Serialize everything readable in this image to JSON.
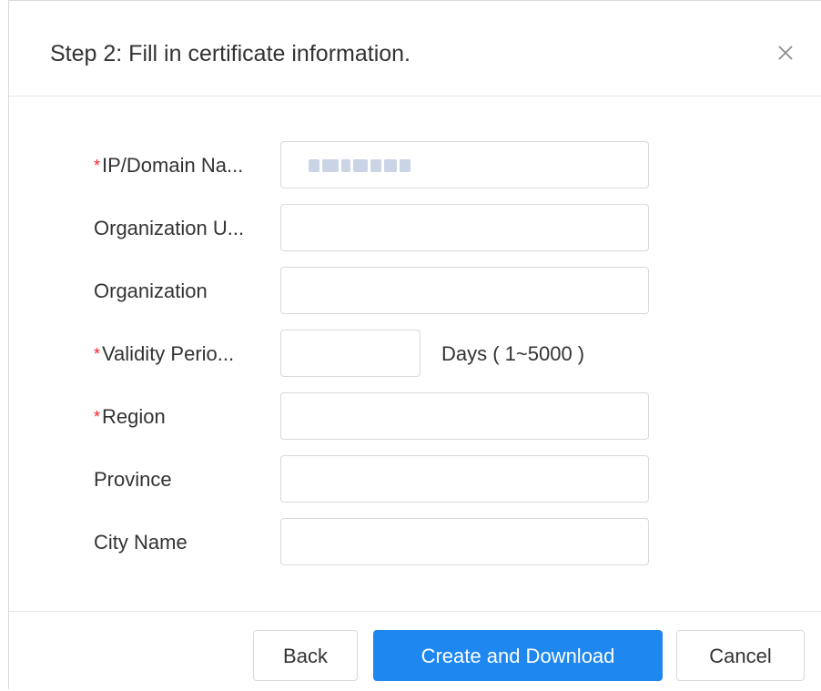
{
  "dialog": {
    "title": "Step 2: Fill in certificate information.",
    "close_icon": "close-icon"
  },
  "form": {
    "fields": [
      {
        "label": "IP/Domain Na...",
        "required": true,
        "value": "",
        "blurred": true
      },
      {
        "label": "Organization U...",
        "required": false,
        "value": ""
      },
      {
        "label": "Organization",
        "required": false,
        "value": ""
      },
      {
        "label": "Validity Perio...",
        "required": true,
        "value": "",
        "suffix": "Days ( 1~5000 )"
      },
      {
        "label": "Region",
        "required": true,
        "value": ""
      },
      {
        "label": "Province",
        "required": false,
        "value": ""
      },
      {
        "label": "City Name",
        "required": false,
        "value": ""
      }
    ],
    "required_mark": "*"
  },
  "footer": {
    "back_label": "Back",
    "create_label": "Create and Download",
    "cancel_label": "Cancel"
  },
  "colors": {
    "primary": "#1e87f0",
    "required": "#f5222d",
    "border": "#d9d9d9"
  }
}
